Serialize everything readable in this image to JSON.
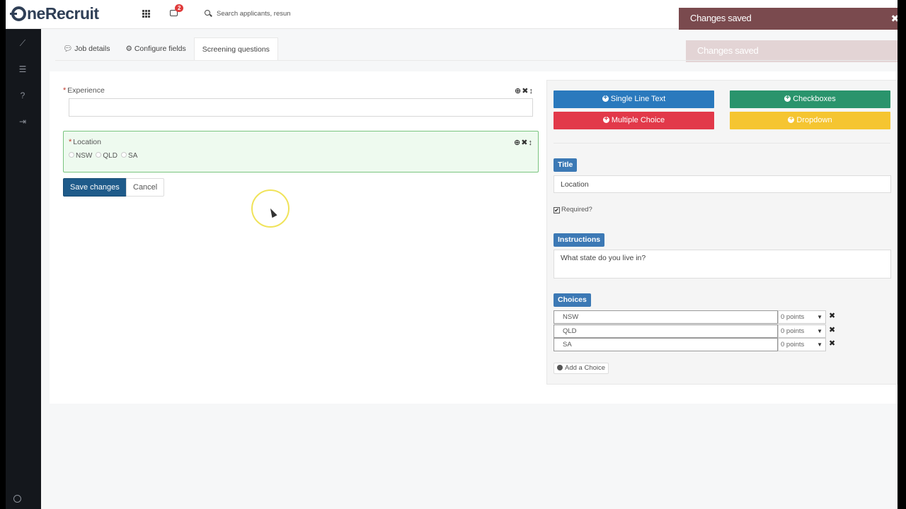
{
  "brand": {
    "name": "neRecruit"
  },
  "header": {
    "notification_count": "2",
    "search_placeholder": "Search applicants, resun"
  },
  "toasts": [
    {
      "text": "Changes saved"
    },
    {
      "text": "Changes saved"
    }
  ],
  "tabs": [
    {
      "label": "Job details",
      "icon": "comment-icon"
    },
    {
      "label": "Configure fields",
      "icon": "gear-icon"
    },
    {
      "label": "Screening questions",
      "icon": "",
      "active": true
    }
  ],
  "form": {
    "experience": {
      "label": "Experience",
      "required_mark": "*",
      "value": ""
    },
    "location": {
      "label": "Location",
      "required_mark": "*",
      "options": [
        "NSW",
        "QLD",
        "SA"
      ]
    },
    "save_label": "Save changes",
    "cancel_label": "Cancel"
  },
  "field_types": {
    "single_line": "Single Line Text",
    "checkboxes": "Checkboxes",
    "multiple_choice": "Multiple Choice",
    "dropdown": "Dropdown"
  },
  "editor": {
    "title_label": "Title",
    "title_value": "Location",
    "required_label": "Required?",
    "required_checked": true,
    "instructions_label": "Instructions",
    "instructions_value": "What state do you live in?",
    "choices_label": "Choices",
    "choices": [
      {
        "text": "NSW",
        "points": "0 points"
      },
      {
        "text": "QLD",
        "points": "0 points"
      },
      {
        "text": "SA",
        "points": "0 points"
      }
    ],
    "add_choice_label": "Add a Choice"
  },
  "colors": {
    "single_line": "#2a79bd",
    "checkboxes": "#2a946c",
    "multiple_choice": "#e2394a",
    "dropdown": "#f5c531",
    "save_button": "#1f5b8a",
    "toast": "#7a4a4e"
  }
}
